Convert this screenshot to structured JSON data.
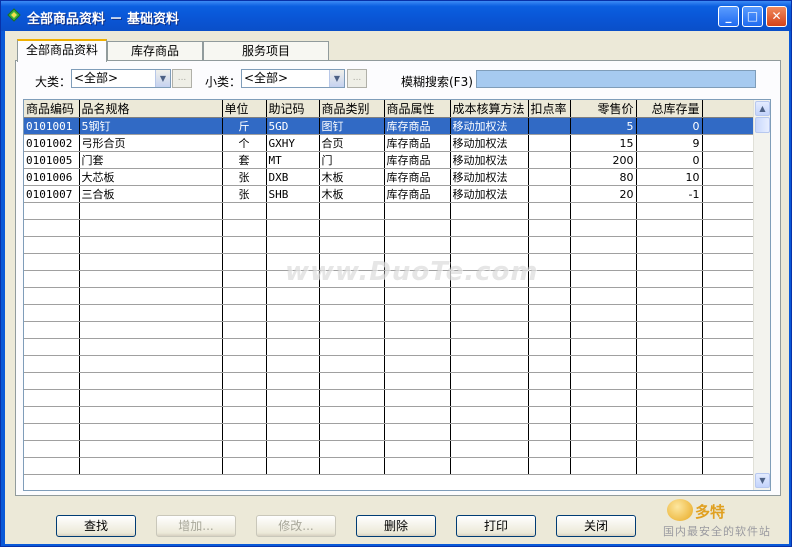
{
  "window": {
    "title": "全部商品资料 － 基础资料",
    "min_label": "_",
    "max_label": "□",
    "close_label": "✕"
  },
  "tabs": [
    {
      "label": "全部商品资料",
      "active": true
    },
    {
      "label": "库存商品",
      "active": false
    },
    {
      "label": "服务项目",
      "active": false
    }
  ],
  "filters": {
    "category_label": "大类：",
    "category_value": "<全部>",
    "subcategory_label": "小类：",
    "subcategory_value": "<全部>",
    "ellipsis": "...",
    "search_label": "模糊搜索(F3)",
    "search_value": ""
  },
  "grid": {
    "columns": [
      "商品编码",
      "品名规格",
      "单位",
      "助记码",
      "商品类别",
      "商品属性",
      "成本核算方法",
      "扣点率",
      "零售价",
      "总库存量"
    ],
    "rows": [
      [
        "0101001",
        "5钢钉",
        "斤",
        "5GD",
        "图钉",
        "库存商品",
        "移动加权法",
        "",
        "5",
        "0"
      ],
      [
        "0101002",
        "弓形合页",
        "个",
        "GXHY",
        "合页",
        "库存商品",
        "移动加权法",
        "",
        "15",
        "9"
      ],
      [
        "0101005",
        "门套",
        "套",
        "MT",
        "门",
        "库存商品",
        "移动加权法",
        "",
        "200",
        "0"
      ],
      [
        "0101006",
        "大芯板",
        "张",
        "DXB",
        "木板",
        "库存商品",
        "移动加权法",
        "",
        "80",
        "10"
      ],
      [
        "0101007",
        "三合板",
        "张",
        "SHB",
        "木板",
        "库存商品",
        "移动加权法",
        "",
        "20",
        "-1"
      ]
    ],
    "selected_row": 0
  },
  "actions": {
    "find": "查找",
    "add": "增加...",
    "edit": "修改...",
    "delete": "删除",
    "print": "打印",
    "close": "关闭"
  },
  "watermark": "www.DuoTe.com",
  "corner_logo": {
    "brand": "多特",
    "sub": "国内最安全的软件站"
  },
  "colors": {
    "titlebar": "#0a55d5",
    "selection": "#316ac5",
    "search_field": "#a6caf0",
    "window_face": "#ece9d8"
  }
}
